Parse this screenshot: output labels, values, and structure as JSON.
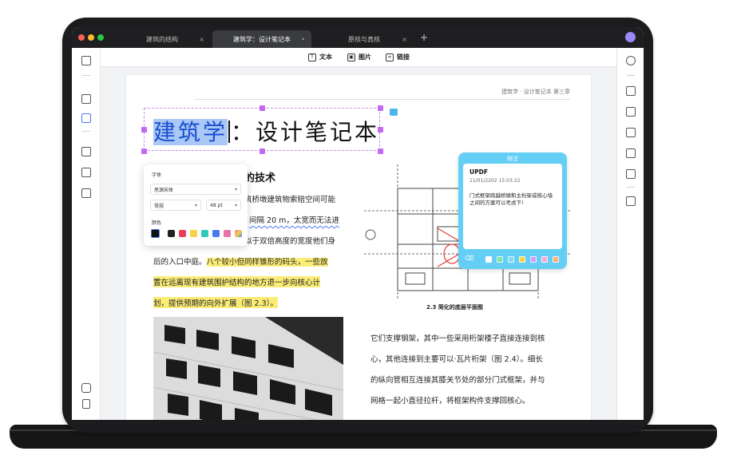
{
  "tabs": [
    {
      "label": "建筑的结构",
      "close": "×"
    },
    {
      "label": "建筑学：设计笔记本",
      "close": "•"
    },
    {
      "label": "原核与真核",
      "close": "×"
    }
  ],
  "new_tab": "+",
  "toolbar": {
    "text": "文本",
    "image": "图片",
    "link": "链接",
    "text_icon": "T",
    "image_icon": "▣",
    "link_icon": "∞"
  },
  "page": {
    "running_head": "建筑学 · 设计笔记本 第三章",
    "title_selected": "建筑学",
    "title_rest": "：设计笔记本",
    "subhead": "的技术",
    "lines": [
      "筑桥墩建筑物索赔空间可能",
      "间隔 20 m，太宽而无法进",
      "似于双倍高度的宽度他们身",
      "后的入口中庭。",
      "八个较小但同样锥形的码头，一些放",
      "置在远离现有建筑围护结构的地方退一步向核心计",
      "划，提供预期的向外扩展（图 2.3）。"
    ],
    "right_lines": [
      "它们支撑钢架，其中一些采用桁架楼子直接连接到核",
      "心，其他连接到主要可以·瓦片桁架（图 2.4）。细长",
      "的纵向管相互连接其膝关节处的部分门式框架，并与",
      "网格一起小直径拉杆，将框架构件支撑回核心。"
    ],
    "figure_caption": "2.3 简化的底层平面图"
  },
  "font_panel": {
    "font_label": "字体",
    "font_family": "思源宋体",
    "weight": "常规",
    "size": "48 pt",
    "color_label": "颜色",
    "swatches": [
      "#111111",
      "#222222",
      "#e83e5c",
      "#f5d347",
      "#2fc9b8",
      "#4a7cf0",
      "#e874a8"
    ]
  },
  "note": {
    "header": "附注",
    "author": "UPDF",
    "time": "11/01/2202 15:03:22",
    "text": "门式框架跨越桥墩和主桁架或核心墙之间的方案可以考虑下!",
    "swatches": [
      "#ffffff",
      "#7fe3a5",
      "#7fd9f0",
      "#f5d347",
      "#c3a3f7",
      "#f7a8d0",
      "#f7b27a"
    ]
  },
  "colors": {
    "accent": "#4a7cf0",
    "selection_border": "#c78bf0",
    "note": "#65cef5",
    "highlight": "#fbec78"
  }
}
